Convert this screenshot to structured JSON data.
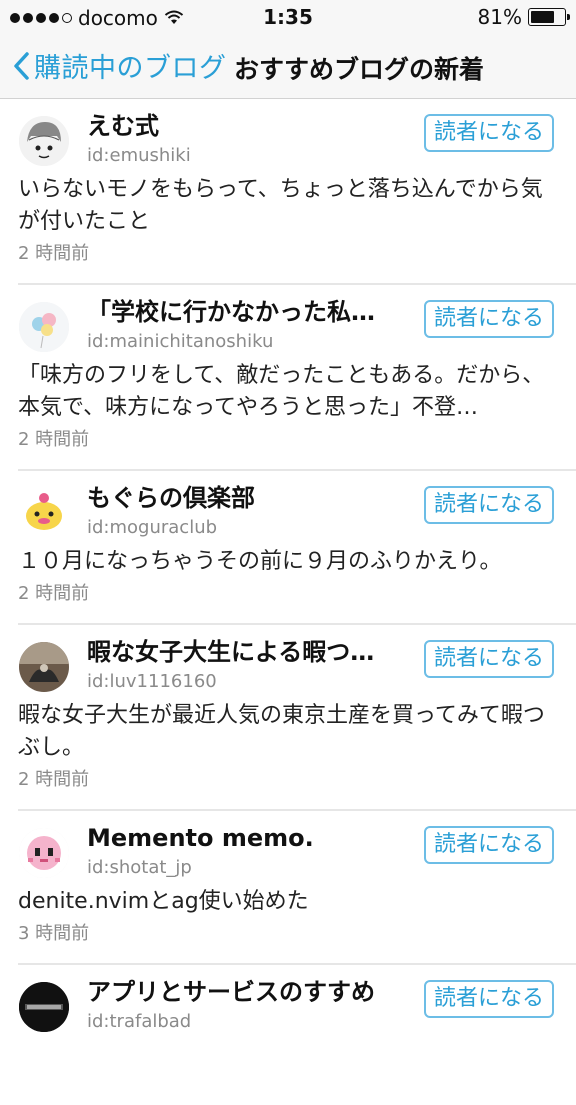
{
  "status_bar": {
    "carrier": "docomo",
    "time": "1:35",
    "battery": "81%",
    "battery_level": 0.81
  },
  "nav": {
    "back_label": "購読中のブログ",
    "title": "おすすめブログの新着"
  },
  "feed": [
    {
      "name": "えむ式",
      "id": "id:emushiki",
      "button": "読者になる",
      "entry": "いらないモノをもらって、ちょっと落ち込んでから気が付いたこと",
      "time": "2 時間前",
      "avatar": "person-face-avatar"
    },
    {
      "name": "「学校に行かなかった私…",
      "id": "id:mainichitanoshiku",
      "button": "読者になる",
      "entry": "「味方のフリをして、敵だったこともある。だから、本気で、味方になってやろうと思った」不登…",
      "time": "2 時間前",
      "avatar": "balloons-avatar"
    },
    {
      "name": "もぐらの倶楽部",
      "id": "id:moguraclub",
      "button": "読者になる",
      "entry": "１０月になっちゃうその前に９月のふりかえり。",
      "time": "2 時間前",
      "avatar": "mole-character-avatar"
    },
    {
      "name": "暇な女子大生による暇つ…",
      "id": "id:luv1116160",
      "button": "読者になる",
      "entry": "暇な女子大生が最近人気の東京土産を買ってみて暇つぶし。",
      "time": "2 時間前",
      "avatar": "photo-avatar"
    },
    {
      "name": "Memento memo.",
      "id": "id:shotat_jp",
      "button": "読者になる",
      "entry": "denite.nvimとag使い始めた",
      "time": "3 時間前",
      "avatar": "pixel-character-avatar"
    },
    {
      "name": "アプリとサービスのすすめ",
      "id": "id:trafalbad",
      "button": "読者になる",
      "entry": "",
      "time": "",
      "avatar": "black-logo-avatar"
    }
  ]
}
